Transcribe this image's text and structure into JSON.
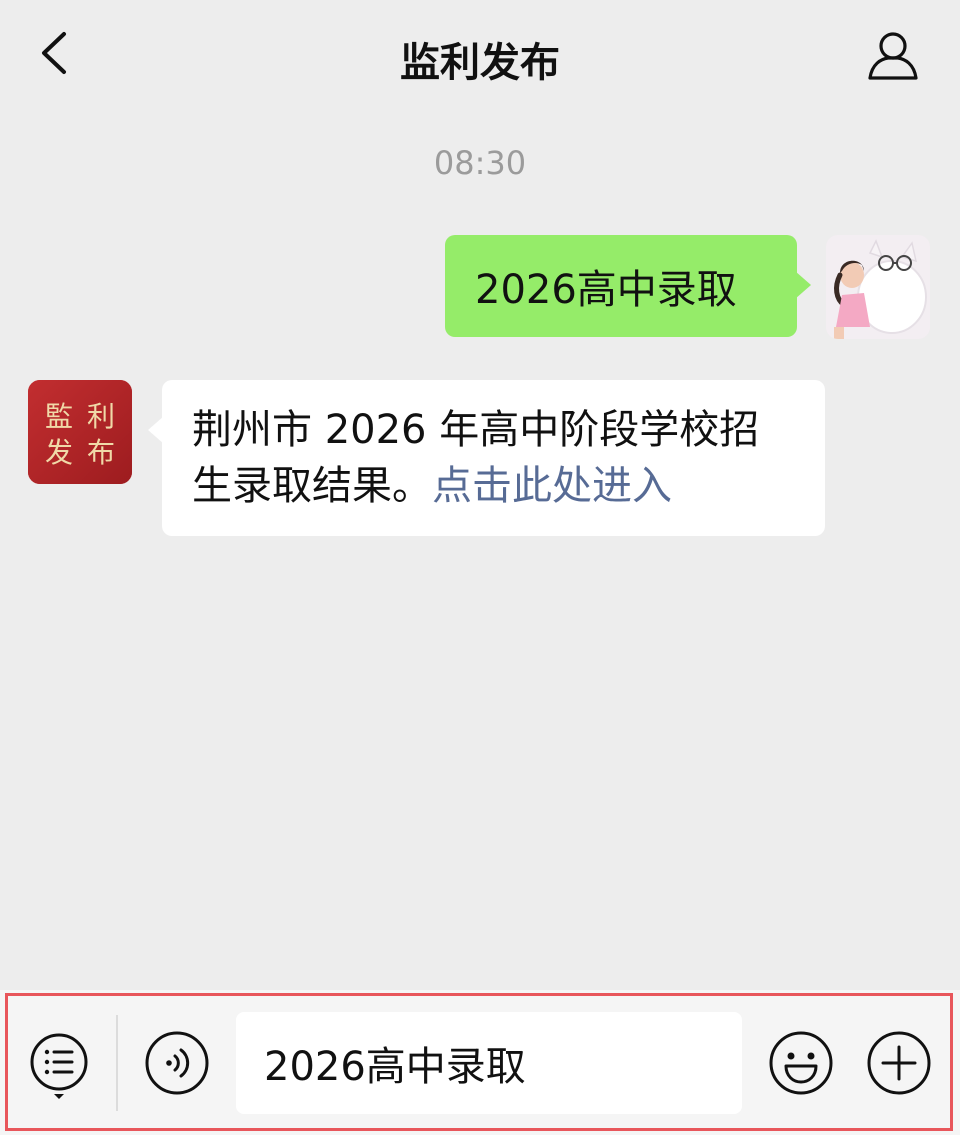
{
  "header": {
    "title": "监利发布",
    "back_icon": "chevron-left-icon",
    "profile_icon": "person-icon"
  },
  "chat": {
    "timestamp": "08:30",
    "messages": [
      {
        "from": "me",
        "text": "2026高中录取"
      },
      {
        "from": "official",
        "text": "荆州市 2026 年高中阶段学校招生录取结果。",
        "link_text": "点击此处进入",
        "avatar_text": [
          "監",
          "利",
          "发",
          "布"
        ]
      }
    ]
  },
  "input_bar": {
    "value": "2026高中录取",
    "menu_icon": "list-menu-icon",
    "voice_icon": "voice-icon",
    "emoji_icon": "emoji-icon",
    "plus_icon": "plus-icon"
  },
  "colors": {
    "background": "#ededed",
    "my_bubble": "#95ec69",
    "link": "#576b95",
    "official_avatar": "#b9262a",
    "highlight_box": "#e8565b"
  }
}
